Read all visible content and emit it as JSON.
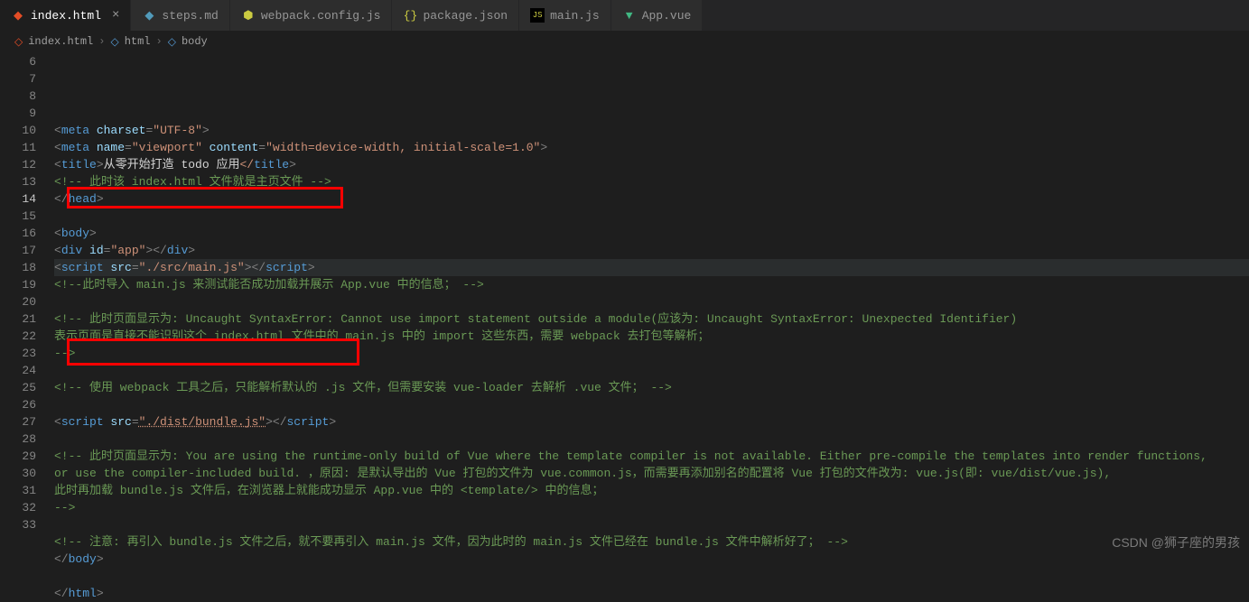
{
  "tabs": [
    {
      "label": "index.html",
      "icon": "html5",
      "active": true,
      "close": true
    },
    {
      "label": "steps.md",
      "icon": "md"
    },
    {
      "label": "webpack.config.js",
      "icon": "js"
    },
    {
      "label": "package.json",
      "icon": "json"
    },
    {
      "label": "main.js",
      "icon": "mjs"
    },
    {
      "label": "App.vue",
      "icon": "vue"
    }
  ],
  "breadcrumbs": {
    "items": [
      "index.html",
      "html",
      "body"
    ],
    "sep": "›"
  },
  "gutter": {
    "start": 6,
    "end": 33,
    "highlight": 14
  },
  "code": {
    "l6": {
      "indent": "    ",
      "a": "<",
      "b": "meta",
      "c": " charset",
      "d": "=",
      "e": "\"UTF-8\"",
      "f": ">"
    },
    "l7": {
      "indent": "    ",
      "a": "<",
      "b": "meta",
      "c": " name",
      "d": "=",
      "e": "\"viewport\"",
      "f": " content",
      "g": "=",
      "h": "\"width=device-width, initial-scale=1.0\"",
      "i": ">"
    },
    "l8": {
      "indent": "    ",
      "a": "<",
      "b": "title",
      "c": ">",
      "d": "从零开始打造 todo 应用",
      "e": "</",
      "f": "title",
      "g": ">"
    },
    "l9": {
      "indent": "    ",
      "cmt": "<!-- 此时该 index.html 文件就是主页文件 -->"
    },
    "l10": {
      "indent": "  ",
      "a": "</",
      "b": "head",
      "c": ">"
    },
    "l11": {
      "blank": true
    },
    "l12": {
      "indent": "  ",
      "a": "<",
      "b": "body",
      "c": ">"
    },
    "l13": {
      "indent": "    ",
      "a": "<",
      "b": "div",
      "c": " id",
      "d": "=",
      "e": "\"app\"",
      "f": "></",
      "g": "div",
      "h": ">"
    },
    "l14": {
      "indent": "    ",
      "a": "<",
      "b": "script",
      "c": " src",
      "d": "=",
      "e": "\"./src/main.js\"",
      "f": "></",
      "g": "script",
      "h": ">"
    },
    "l15": {
      "indent": "    ",
      "cmt": "<!--此时导入 main.js 来测试能否成功加载并展示 App.vue 中的信息； -->"
    },
    "l16": {
      "blank": true
    },
    "l17": {
      "indent": "    ",
      "cmt": "<!-- 此时页面显示为: Uncaught SyntaxError: Cannot use import statement outside a module(应该为: Uncaught SyntaxError: Unexpected Identifier)"
    },
    "l18": {
      "indent": "         ",
      "cmt": "表示页面是直接不能识别这个 index.html 文件中的 main.js 中的 import 这些东西，需要 webpack 去打包等解析；"
    },
    "l19": {
      "indent": "     ",
      "cmt": "-->"
    },
    "l20": {
      "blank": true
    },
    "l21": {
      "indent": "    ",
      "cmt": "<!-- 使用 webpack 工具之后，只能解析默认的 .js 文件，但需要安装 vue-loader 去解析 .vue 文件； -->"
    },
    "l22": {
      "blank": true
    },
    "l23": {
      "indent": "    ",
      "a": "<",
      "b": "script",
      "c": " src",
      "d": "=",
      "e": "\"./dist/bundle.js\"",
      "f": "></",
      "g": "script",
      "h": ">",
      "udl": true
    },
    "l24": {
      "blank": true
    },
    "l25": {
      "indent": "    ",
      "cmt": "<!-- 此时页面显示为: You are using the runtime-only build of Vue where the template compiler is not available. Either pre-compile the templates into render functions,"
    },
    "l26": {
      "indent": "          ",
      "cmt": "or use the compiler-included build. ，原因: 是默认导出的 Vue 打包的文件为 vue.common.js，而需要再添加别名的配置将 Vue 打包的文件改为: vue.js(即: vue/dist/vue.js),"
    },
    "l27": {
      "indent": "          ",
      "cmt": "此时再加载 bundle.js 文件后，在浏览器上就能成功显示 App.vue 中的 <template/> 中的信息；"
    },
    "l28": {
      "indent": "     ",
      "cmt": "-->"
    },
    "l29": {
      "blank": true
    },
    "l30": {
      "indent": "    ",
      "cmt": "<!-- 注意: 再引入 bundle.js 文件之后，就不要再引入 main.js 文件，因为此时的 main.js 文件已经在 bundle.js 文件中解析好了； -->"
    },
    "l31": {
      "indent": "  ",
      "a": "</",
      "b": "body",
      "c": ">"
    },
    "l32": {
      "blank": true
    },
    "l33": {
      "indent": "  ",
      "a": "</",
      "b": "html",
      "c": ">"
    }
  },
  "watermark": "CSDN @狮子座的男孩"
}
